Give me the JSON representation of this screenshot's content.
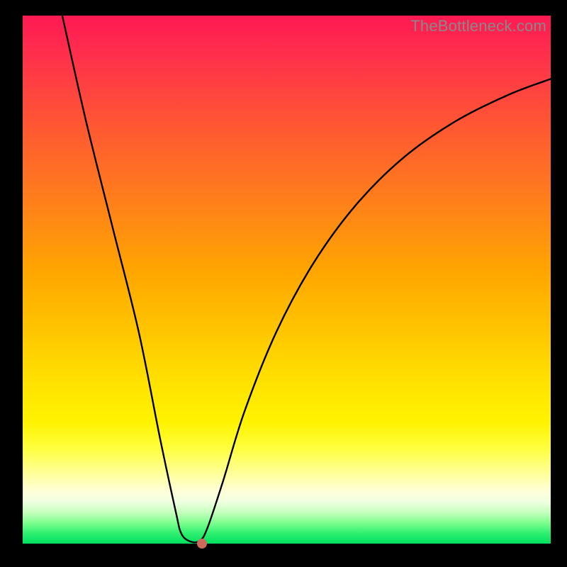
{
  "watermark": "TheBottleneck.com",
  "chart_data": {
    "type": "line",
    "title": "",
    "xlabel": "",
    "ylabel": "",
    "xlim": [
      0,
      100
    ],
    "ylim": [
      0,
      100
    ],
    "series": [
      {
        "name": "curve",
        "points": [
          {
            "x": 7.5,
            "y": 100
          },
          {
            "x": 12,
            "y": 80
          },
          {
            "x": 17,
            "y": 60
          },
          {
            "x": 22,
            "y": 40
          },
          {
            "x": 26,
            "y": 20
          },
          {
            "x": 29,
            "y": 6
          },
          {
            "x": 30,
            "y": 2
          },
          {
            "x": 31.5,
            "y": 0.5
          },
          {
            "x": 33.5,
            "y": 0.5
          },
          {
            "x": 35,
            "y": 3
          },
          {
            "x": 38,
            "y": 12
          },
          {
            "x": 42,
            "y": 25
          },
          {
            "x": 48,
            "y": 40
          },
          {
            "x": 55,
            "y": 53
          },
          {
            "x": 63,
            "y": 64
          },
          {
            "x": 72,
            "y": 73
          },
          {
            "x": 82,
            "y": 80
          },
          {
            "x": 92,
            "y": 85
          },
          {
            "x": 100,
            "y": 88
          }
        ]
      }
    ],
    "marker": {
      "x": 34,
      "y": 0
    },
    "gradient_stops": [
      {
        "pos": 0,
        "color": "#ff1a53"
      },
      {
        "pos": 50,
        "color": "#ffa700"
      },
      {
        "pos": 82,
        "color": "#ffff40"
      },
      {
        "pos": 100,
        "color": "#00e060"
      }
    ]
  }
}
